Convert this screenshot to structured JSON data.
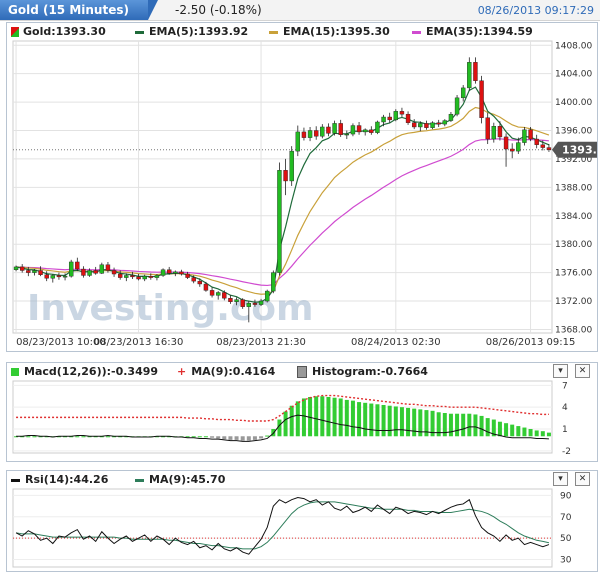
{
  "header": {
    "title": "Gold (15 Minutes)",
    "change": "-2.50 (-0.18%)",
    "timestamp": "08/26/2013 09:17:29"
  },
  "watermark": "Investing.com",
  "colors": {
    "up": "#22bb22",
    "down": "#dd1111",
    "ema5": "#1f6b3a",
    "ema15": "#c9a13a",
    "ema35": "#d04bd0",
    "macd_line": "#111111",
    "macd_signal": "#e03030",
    "macd_hist_pos": "#33cc33",
    "macd_hist_neg": "#999999",
    "rsi_line": "#111111",
    "rsi_ma": "#2e7d5b"
  },
  "price_panel": {
    "legend": {
      "gold": "Gold:1393.30",
      "ema5": "EMA(5):1393.92",
      "ema15": "EMA(15):1395.30",
      "ema35": "EMA(35):1394.59"
    },
    "last_price_label": "1393.30",
    "x_labels": [
      "08/23/2013 10:00",
      "08/23/2013 16:30",
      "08/23/2013 21:30",
      "08/24/2013 02:30",
      "08/26/2013 09:15"
    ]
  },
  "macd_panel": {
    "legend": {
      "macd": "Macd(12,26)):-0.3499",
      "ma": "MA(9):0.4164",
      "hist": "Histogram:-0.7664"
    }
  },
  "rsi_panel": {
    "legend": {
      "rsi": "Rsi(14):44.26",
      "ma": "MA(9):45.70"
    }
  },
  "controls": {
    "minimize": "▾",
    "close": "✕"
  },
  "chart_data": [
    {
      "type": "candlestick",
      "title": "Gold (15 Minutes)",
      "y_axis_ticks": [
        1368,
        1372,
        1376,
        1380,
        1384,
        1388,
        1392,
        1396,
        1400,
        1404,
        1408
      ],
      "ylim": [
        1367.5,
        1408.6
      ],
      "last_price": 1393.3,
      "grid": true,
      "candles": [
        [
          1376.4,
          1377.0,
          1376.2,
          1376.8
        ],
        [
          1376.8,
          1377.2,
          1376.0,
          1376.3
        ],
        [
          1376.3,
          1376.8,
          1375.5,
          1376.0
        ],
        [
          1376.0,
          1376.5,
          1375.6,
          1376.3
        ],
        [
          1376.3,
          1376.9,
          1375.5,
          1375.7
        ],
        [
          1375.7,
          1376.2,
          1374.8,
          1375.2
        ],
        [
          1375.2,
          1375.8,
          1374.6,
          1375.6
        ],
        [
          1375.6,
          1376.0,
          1375.0,
          1375.4
        ],
        [
          1375.4,
          1375.9,
          1374.9,
          1375.5
        ],
        [
          1375.5,
          1377.8,
          1375.3,
          1377.5
        ],
        [
          1377.5,
          1378.1,
          1376.2,
          1376.5
        ],
        [
          1376.5,
          1376.9,
          1375.3,
          1375.6
        ],
        [
          1375.6,
          1376.6,
          1375.4,
          1376.3
        ],
        [
          1376.3,
          1376.8,
          1375.7,
          1375.9
        ],
        [
          1375.9,
          1377.4,
          1375.8,
          1377.1
        ],
        [
          1377.1,
          1377.5,
          1376.0,
          1376.3
        ],
        [
          1376.3,
          1376.7,
          1375.4,
          1375.8
        ],
        [
          1375.8,
          1376.3,
          1375.0,
          1375.3
        ],
        [
          1375.3,
          1375.9,
          1374.8,
          1375.6
        ],
        [
          1375.6,
          1376.1,
          1375.1,
          1375.4
        ],
        [
          1375.4,
          1375.8,
          1374.9,
          1375.1
        ],
        [
          1375.1,
          1375.7,
          1374.8,
          1375.5
        ],
        [
          1375.5,
          1375.9,
          1375.0,
          1375.3
        ],
        [
          1375.3,
          1375.8,
          1374.9,
          1375.6
        ],
        [
          1375.6,
          1376.6,
          1375.4,
          1376.4
        ],
        [
          1376.4,
          1376.8,
          1375.7,
          1375.9
        ],
        [
          1375.9,
          1376.3,
          1375.5,
          1376.1
        ],
        [
          1376.1,
          1376.4,
          1375.6,
          1375.8
        ],
        [
          1375.8,
          1376.1,
          1375.1,
          1375.3
        ],
        [
          1375.3,
          1375.6,
          1374.5,
          1374.8
        ],
        [
          1374.8,
          1375.2,
          1374.0,
          1374.4
        ],
        [
          1374.4,
          1374.7,
          1373.3,
          1373.5
        ],
        [
          1373.5,
          1373.9,
          1372.5,
          1372.8
        ],
        [
          1372.8,
          1373.4,
          1372.2,
          1373.2
        ],
        [
          1373.2,
          1373.5,
          1372.1,
          1372.4
        ],
        [
          1372.4,
          1372.8,
          1371.6,
          1371.9
        ],
        [
          1371.9,
          1372.5,
          1371.4,
          1372.2
        ],
        [
          1372.2,
          1372.4,
          1370.9,
          1371.2
        ],
        [
          1371.2,
          1372.0,
          1369.0,
          1371.7
        ],
        [
          1371.7,
          1372.2,
          1371.2,
          1371.5
        ],
        [
          1371.5,
          1372.3,
          1371.3,
          1372.0
        ],
        [
          1372.0,
          1373.6,
          1371.8,
          1373.4
        ],
        [
          1373.4,
          1376.3,
          1373.1,
          1376.0
        ],
        [
          1376.0,
          1391.5,
          1375.6,
          1390.4
        ],
        [
          1390.4,
          1392.0,
          1386.9,
          1388.9
        ],
        [
          1388.9,
          1393.8,
          1388.2,
          1393.1
        ],
        [
          1393.1,
          1396.7,
          1392.4,
          1395.8
        ],
        [
          1395.8,
          1396.4,
          1394.6,
          1395.0
        ],
        [
          1395.0,
          1396.5,
          1394.5,
          1396.0
        ],
        [
          1396.0,
          1396.6,
          1394.7,
          1395.2
        ],
        [
          1395.2,
          1396.9,
          1394.9,
          1396.5
        ],
        [
          1396.5,
          1397.0,
          1395.2,
          1395.6
        ],
        [
          1395.6,
          1397.4,
          1395.3,
          1397.0
        ],
        [
          1397.0,
          1397.5,
          1395.1,
          1395.4
        ],
        [
          1395.4,
          1396.0,
          1394.8,
          1395.5
        ],
        [
          1395.5,
          1397.0,
          1395.2,
          1396.7
        ],
        [
          1396.7,
          1397.2,
          1395.4,
          1395.8
        ],
        [
          1395.8,
          1396.3,
          1395.3,
          1396.1
        ],
        [
          1396.1,
          1396.6,
          1395.4,
          1395.7
        ],
        [
          1395.7,
          1397.4,
          1395.5,
          1397.2
        ],
        [
          1397.2,
          1398.2,
          1396.6,
          1397.9
        ],
        [
          1397.9,
          1398.5,
          1397.1,
          1397.5
        ],
        [
          1397.5,
          1399.0,
          1397.3,
          1398.7
        ],
        [
          1398.7,
          1399.2,
          1397.9,
          1398.3
        ],
        [
          1398.3,
          1398.7,
          1396.8,
          1397.1
        ],
        [
          1397.1,
          1397.6,
          1396.2,
          1396.5
        ],
        [
          1396.5,
          1397.3,
          1395.9,
          1397.0
        ],
        [
          1397.0,
          1397.4,
          1396.1,
          1396.4
        ],
        [
          1396.4,
          1397.3,
          1396.2,
          1397.1
        ],
        [
          1397.1,
          1397.5,
          1396.5,
          1396.9
        ],
        [
          1396.9,
          1397.6,
          1396.6,
          1397.4
        ],
        [
          1397.4,
          1398.6,
          1397.2,
          1398.3
        ],
        [
          1398.3,
          1401.0,
          1398.0,
          1400.6
        ],
        [
          1400.6,
          1402.4,
          1400.1,
          1402.0
        ],
        [
          1402.0,
          1406.3,
          1401.6,
          1405.6
        ],
        [
          1405.6,
          1406.3,
          1402.6,
          1403.0
        ],
        [
          1403.0,
          1403.7,
          1397.0,
          1397.8
        ],
        [
          1397.8,
          1398.5,
          1394.1,
          1394.8
        ],
        [
          1394.8,
          1397.1,
          1394.3,
          1396.6
        ],
        [
          1396.6,
          1397.3,
          1394.6,
          1395.1
        ],
        [
          1395.1,
          1395.6,
          1390.9,
          1393.4
        ],
        [
          1393.4,
          1394.2,
          1392.1,
          1393.1
        ],
        [
          1393.1,
          1395.0,
          1392.7,
          1394.3
        ],
        [
          1394.3,
          1396.5,
          1393.9,
          1396.1
        ],
        [
          1396.1,
          1396.5,
          1394.5,
          1394.8
        ],
        [
          1394.8,
          1395.4,
          1393.5,
          1394.0
        ],
        [
          1394.0,
          1394.6,
          1393.2,
          1393.6
        ],
        [
          1393.6,
          1394.1,
          1393.0,
          1393.3
        ]
      ]
    },
    {
      "type": "line",
      "title": "Macd(12,26))",
      "y_axis_ticks": [
        -2,
        1,
        4,
        7
      ],
      "ylim": [
        -2.3,
        7.6
      ],
      "zero_line": 0,
      "series": [
        {
          "name": "Macd(12,26))",
          "values": [
            0.0,
            0.0,
            0.1,
            0.1,
            0.0,
            0.0,
            -0.1,
            0.0,
            0.0,
            0.0,
            0.1,
            0.1,
            0.0,
            0.0,
            0.0,
            0.1,
            0.0,
            0.0,
            0.0,
            -0.1,
            -0.1,
            -0.1,
            -0.1,
            0.0,
            0.0,
            0.0,
            -0.1,
            -0.1,
            -0.2,
            -0.2,
            -0.3,
            -0.3,
            -0.4,
            -0.4,
            -0.5,
            -0.6,
            -0.6,
            -0.7,
            -0.7,
            -0.6,
            -0.5,
            -0.3,
            0.4,
            1.5,
            2.3,
            2.7,
            2.9,
            2.8,
            2.6,
            2.4,
            2.2,
            2.0,
            1.8,
            1.6,
            1.5,
            1.3,
            1.2,
            1.0,
            0.9,
            0.8,
            0.8,
            0.8,
            0.9,
            0.9,
            0.8,
            0.7,
            0.6,
            0.6,
            0.5,
            0.5,
            0.5,
            0.6,
            0.8,
            1.0,
            1.3,
            1.3,
            1.0,
            0.6,
            0.3,
            0.1,
            -0.1,
            -0.2,
            -0.2,
            -0.2,
            -0.2,
            -0.3,
            -0.3,
            -0.35
          ]
        },
        {
          "name": "MA(9)",
          "values": [
            0.0,
            0.0,
            0.0,
            0.0,
            0.0,
            0.0,
            0.0,
            0.0,
            0.0,
            0.0,
            0.0,
            0.0,
            0.0,
            0.0,
            0.0,
            0.0,
            0.0,
            0.0,
            0.0,
            0.0,
            0.0,
            0.0,
            0.0,
            0.0,
            0.0,
            0.0,
            0.0,
            0.0,
            -0.1,
            -0.1,
            -0.1,
            -0.2,
            -0.2,
            -0.3,
            -0.3,
            -0.3,
            -0.4,
            -0.4,
            -0.5,
            -0.5,
            -0.5,
            -0.5,
            -0.3,
            0.2,
            0.8,
            1.4,
            2.0,
            2.4,
            2.7,
            2.9,
            3.0,
            3.0,
            3.0,
            2.9,
            2.8,
            2.7,
            2.6,
            2.5,
            2.4,
            2.3,
            2.2,
            2.1,
            2.0,
            1.9,
            1.8,
            1.8,
            1.7,
            1.6,
            1.6,
            1.5,
            1.5,
            1.4,
            1.4,
            1.4,
            1.4,
            1.4,
            1.3,
            1.2,
            1.1,
            1.0,
            0.9,
            0.8,
            0.7,
            0.6,
            0.5,
            0.5,
            0.4,
            0.42
          ]
        },
        {
          "name": "Histogram",
          "values": [
            0.0,
            0.0,
            0.1,
            0.1,
            0.0,
            0.0,
            -0.1,
            0.0,
            0.0,
            0.0,
            0.1,
            0.1,
            0.0,
            0.0,
            0.0,
            0.1,
            0.0,
            0.0,
            0.0,
            -0.1,
            -0.1,
            -0.1,
            -0.1,
            0.0,
            0.0,
            0.0,
            -0.1,
            -0.1,
            -0.1,
            -0.1,
            -0.2,
            -0.1,
            -0.2,
            -0.1,
            -0.2,
            -0.3,
            -0.2,
            -0.3,
            -0.2,
            -0.1,
            0.0,
            0.2,
            0.7,
            1.3,
            1.5,
            1.3,
            0.9,
            0.4,
            -0.1,
            -0.5,
            -0.8,
            -1.0,
            -1.2,
            -1.3,
            -1.3,
            -1.4,
            -1.4,
            -1.5,
            -1.5,
            -1.5,
            -1.4,
            -1.3,
            -1.1,
            -1.0,
            -1.0,
            -1.1,
            -1.1,
            -1.0,
            -1.1,
            -1.0,
            -1.0,
            -0.8,
            -0.6,
            -0.4,
            -0.1,
            -0.1,
            -0.3,
            -0.6,
            -0.8,
            -0.9,
            -1.0,
            -1.0,
            -0.9,
            -0.8,
            -0.7,
            -0.8,
            -0.7,
            -0.77
          ]
        }
      ],
      "displayed_columns": [
        0.0,
        0.0,
        0.0,
        0.0,
        0.0,
        0.0,
        0.0,
        0.0,
        0.0,
        0.0,
        0.0,
        0.0,
        0.0,
        0.0,
        0.0,
        0.0,
        0.0,
        0.0,
        0.0,
        0.0,
        0.0,
        0.0,
        0.0,
        0.0,
        0.0,
        0.0,
        0.0,
        0.0,
        0.0,
        0.0,
        0.0,
        0.0,
        -0.2,
        -0.3,
        -0.4,
        -0.5,
        -0.5,
        -0.6,
        -0.6,
        -0.5,
        -0.3,
        0.1,
        1.0,
        2.3,
        3.4,
        4.2,
        4.8,
        5.2,
        5.4,
        5.5,
        5.5,
        5.4,
        5.3,
        5.2,
        5.0,
        4.9,
        4.7,
        4.6,
        4.5,
        4.4,
        4.3,
        4.2,
        4.1,
        4.0,
        3.9,
        3.8,
        3.7,
        3.6,
        3.5,
        3.3,
        3.2,
        3.1,
        3.1,
        3.1,
        3.1,
        3.0,
        2.8,
        2.5,
        2.3,
        2.0,
        1.8,
        1.6,
        1.4,
        1.2,
        1.0,
        0.8,
        0.7,
        0.5
      ]
    },
    {
      "type": "line",
      "title": "Rsi(14)",
      "y_axis_ticks": [
        30,
        50,
        70,
        90
      ],
      "ylim": [
        23,
        96
      ],
      "reference_line": 50,
      "series": [
        {
          "name": "Rsi(14)",
          "values": [
            55,
            52,
            57,
            54,
            48,
            50,
            45,
            52,
            51,
            55,
            58,
            49,
            52,
            47,
            56,
            50,
            45,
            49,
            52,
            47,
            50,
            53,
            47,
            52,
            49,
            44,
            50,
            46,
            44,
            47,
            41,
            43,
            39,
            45,
            40,
            38,
            41,
            37,
            35,
            42,
            49,
            60,
            80,
            86,
            83,
            86,
            88,
            87,
            84,
            86,
            81,
            84,
            78,
            76,
            80,
            74,
            76,
            79,
            75,
            81,
            77,
            73,
            79,
            77,
            73,
            75,
            74,
            72,
            75,
            73,
            76,
            79,
            81,
            82,
            86,
            71,
            60,
            55,
            52,
            47,
            53,
            48,
            50,
            44,
            46,
            44,
            42,
            44
          ]
        },
        {
          "name": "MA(9)",
          "values": [
            55,
            54,
            54,
            54,
            53,
            52,
            51,
            51,
            51,
            51,
            51,
            51,
            51,
            51,
            51,
            51,
            51,
            50,
            50,
            49,
            49,
            49,
            49,
            49,
            49,
            48,
            48,
            47,
            46,
            45,
            45,
            44,
            43,
            43,
            42,
            41,
            41,
            40,
            40,
            40,
            42,
            46,
            52,
            59,
            66,
            73,
            78,
            81,
            83,
            84,
            84,
            84,
            84,
            83,
            82,
            81,
            80,
            79,
            78,
            78,
            77,
            77,
            77,
            77,
            76,
            76,
            75,
            75,
            75,
            74,
            74,
            74,
            75,
            76,
            77,
            76,
            75,
            73,
            70,
            66,
            63,
            59,
            55,
            52,
            50,
            48,
            47,
            45.7
          ]
        }
      ]
    }
  ]
}
